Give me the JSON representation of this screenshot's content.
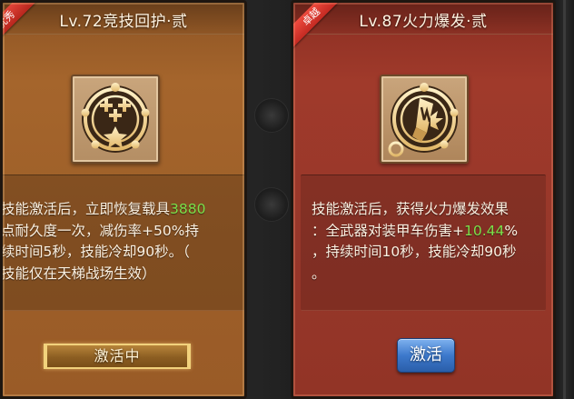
{
  "cards": [
    {
      "ribbon": "优秀",
      "title": "Lv.72竞技回护·贰",
      "icon": "repair-stars-emblem-icon",
      "description": {
        "lines": [
          {
            "pre": "技能激活后，立即恢复载具",
            "highlight": "3880",
            "post": ""
          },
          {
            "pre": "点耐久度一次，减伤率+50%持",
            "highlight": "",
            "post": ""
          },
          {
            "pre": "续时间5秒，技能冷却90秒。（",
            "highlight": "",
            "post": ""
          },
          {
            "pre": "技能仅在天梯战场生效）",
            "highlight": "",
            "post": ""
          }
        ]
      },
      "button": "激活中",
      "accent": "#9d5f29"
    },
    {
      "ribbon": "卓越",
      "title": "Lv.87火力爆发·贰",
      "icon": "firepower-shell-emblem-icon",
      "description": {
        "lines": [
          {
            "pre": "技能激活后，获得火力爆发效果",
            "highlight": "",
            "post": ""
          },
          {
            "pre": "：全武器对装甲车伤害+",
            "highlight": "10.44",
            "post": "%"
          },
          {
            "pre": "，持续时间10秒，技能冷却90秒",
            "highlight": "",
            "post": ""
          },
          {
            "pre": "。",
            "highlight": "",
            "post": ""
          }
        ]
      },
      "button": "激活",
      "accent": "#97372a"
    }
  ],
  "colors": {
    "highlight_value": "#7be04a",
    "activate_button": "#3d79cc"
  }
}
